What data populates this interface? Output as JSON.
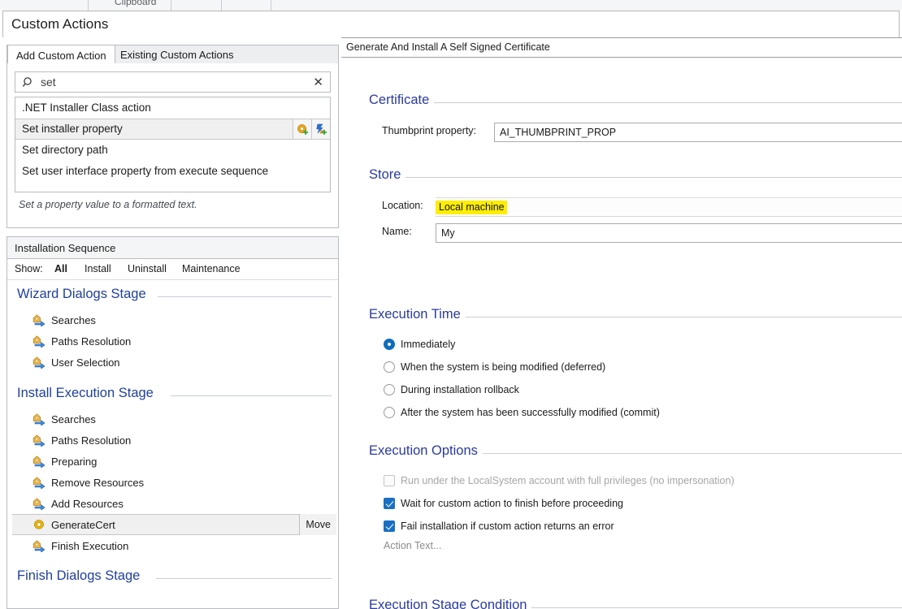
{
  "ribbon": {
    "group_label": "Clipboard"
  },
  "header": {
    "title": "Custom Actions"
  },
  "left": {
    "tabs": [
      {
        "label": "Add Custom Action",
        "active": true
      },
      {
        "label": "Existing Custom Actions",
        "active": false
      }
    ],
    "search": {
      "value": "set",
      "placeholder": "Search",
      "clear_glyph": "✕",
      "icon": "search-icon"
    },
    "results": [
      {
        "label": ".NET Installer Class action",
        "selected": false
      },
      {
        "label": "Set installer property",
        "selected": true
      },
      {
        "label": "Set directory path",
        "selected": false
      },
      {
        "label": "Set user interface property from execute sequence",
        "selected": false
      }
    ],
    "result_actions": [
      {
        "name": "add-custom-action-gear-icon"
      },
      {
        "name": "add-custom-action-bolt-icon"
      }
    ],
    "description": "Set a property value to a formatted text.",
    "sequence": {
      "header": "Installation Sequence",
      "show_label": "Show:",
      "show_options": [
        {
          "label": "All",
          "active": true
        },
        {
          "label": "Install",
          "active": false
        },
        {
          "label": "Uninstall",
          "active": false
        },
        {
          "label": "Maintenance",
          "active": false
        }
      ],
      "stages": [
        {
          "title": "Wizard Dialogs Stage",
          "items": [
            {
              "label": "Searches",
              "icon": "sequence-step-icon",
              "selected": false
            },
            {
              "label": "Paths Resolution",
              "icon": "sequence-step-icon",
              "selected": false
            },
            {
              "label": "User Selection",
              "icon": "sequence-step-icon",
              "selected": false
            }
          ]
        },
        {
          "title": "Install Execution Stage",
          "items": [
            {
              "label": "Searches",
              "icon": "sequence-step-icon",
              "selected": false
            },
            {
              "label": "Paths Resolution",
              "icon": "sequence-step-icon",
              "selected": false
            },
            {
              "label": "Preparing",
              "icon": "sequence-step-icon",
              "selected": false
            },
            {
              "label": "Remove Resources",
              "icon": "sequence-step-icon",
              "selected": false
            },
            {
              "label": "Add Resources",
              "icon": "sequence-step-icon",
              "selected": false
            },
            {
              "label": "GenerateCert",
              "icon": "custom-action-gear-icon",
              "selected": true,
              "button": "Move"
            },
            {
              "label": "Finish Execution",
              "icon": "sequence-step-icon",
              "selected": false
            }
          ]
        },
        {
          "title": "Finish Dialogs Stage",
          "items": []
        }
      ]
    }
  },
  "right": {
    "header_title": "Generate And Install A Self Signed Certificate",
    "groups": {
      "certificate": {
        "title": "Certificate",
        "thumbprint_label": "Thumbprint property:",
        "thumbprint_value": "AI_THUMBPRINT_PROP"
      },
      "store": {
        "title": "Store",
        "location_label": "Location:",
        "location_value": "Local machine",
        "name_label": "Name:",
        "name_value": "My"
      },
      "execution_time": {
        "title": "Execution Time",
        "options": [
          {
            "label": "Immediately",
            "checked": true
          },
          {
            "label": "When the system is being modified (deferred)",
            "checked": false
          },
          {
            "label": "During installation rollback",
            "checked": false
          },
          {
            "label": "After the system has been successfully modified (commit)",
            "checked": false
          }
        ]
      },
      "execution_options": {
        "title": "Execution Options",
        "options": [
          {
            "label": "Run under the LocalSystem account with full privileges (no impersonation)",
            "checked": false,
            "disabled": true
          },
          {
            "label": "Wait for custom action to finish before proceeding",
            "checked": true,
            "disabled": false
          },
          {
            "label": "Fail installation if custom action returns an error",
            "checked": true,
            "disabled": false
          }
        ],
        "action_text": "Action Text..."
      },
      "execution_stage_condition": {
        "title": "Execution Stage Condition"
      }
    }
  },
  "colors": {
    "accent_blue": "#2a3b9e",
    "stage_blue": "#1f3f9e",
    "highlight_yellow": "#ffee00",
    "checkbox_blue": "#1870c4",
    "radio_blue": "#0f6cbd"
  }
}
